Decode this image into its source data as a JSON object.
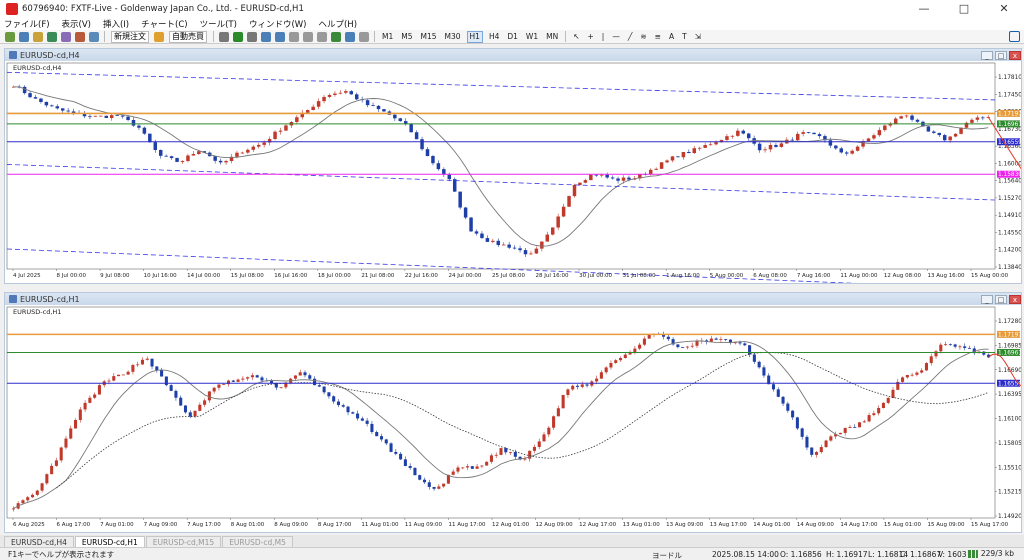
{
  "app": {
    "title": "60796940: FXTF-Live - Goldenway Japan Co., Ltd. - EURUSD-cd,H1",
    "window_controls": [
      "—",
      "□",
      "✕"
    ]
  },
  "menu": [
    "ファイル(F)",
    "表示(V)",
    "挿入(I)",
    "チャート(C)",
    "ツール(T)",
    "ウィンドウ(W)",
    "ヘルプ(H)"
  ],
  "toolbar": {
    "new_order": "新規注文",
    "auto_trade": "自動売買",
    "timeframes": [
      "M1",
      "M5",
      "M15",
      "M30",
      "H1",
      "H4",
      "D1",
      "W1",
      "MN"
    ],
    "active_timeframe": "H1"
  },
  "chart_h4": {
    "window_title": "EURUSD-cd,H4",
    "symbol_label": "EURUSD-cd,H4",
    "price_ticks": [
      "1.17810",
      "1.17450",
      "1.17090",
      "1.16730",
      "1.16360",
      "1.16000",
      "1.15640",
      "1.15270",
      "1.14910",
      "1.14550",
      "1.14200",
      "1.13840"
    ],
    "price_labels": [
      {
        "text": "1.17197",
        "color": "#e69a3a"
      },
      {
        "text": "1.16961",
        "color": "#2e8b2e"
      },
      {
        "text": "1.16559",
        "color": "#2d2dcc"
      },
      {
        "text": "1.15830",
        "color": "#ee22ee"
      }
    ],
    "time_ticks": [
      "4 Jul 2025",
      "8 Jul 00:00",
      "9 Jul 08:00",
      "10 Jul 16:00",
      "14 Jul 00:00",
      "15 Jul 08:00",
      "16 Jul 16:00",
      "18 Jul 00:00",
      "21 Jul 08:00",
      "22 Jul 16:00",
      "24 Jul 00:00",
      "25 Jul 08:00",
      "28 Jul 16:00",
      "30 Jul 00:00",
      "31 Jul 08:00",
      "1 Aug 16:00",
      "5 Aug 00:00",
      "6 Aug 08:00",
      "7 Aug 16:00",
      "11 Aug 00:00",
      "12 Aug 08:00",
      "13 Aug 16:00",
      "15 Aug 00:00"
    ]
  },
  "chart_h1": {
    "window_title": "EURUSD-cd,H1",
    "symbol_label": "EURUSD-cd,H1",
    "price_ticks": [
      "1.17280",
      "1.16985",
      "1.16690",
      "1.16395",
      "1.16100",
      "1.15805",
      "1.15510",
      "1.15215",
      "1.14920"
    ],
    "price_labels": [
      {
        "text": "1.17197",
        "color": "#e69a3a"
      },
      {
        "text": "1.16961",
        "color": "#2e8b2e"
      },
      {
        "text": "1.16559",
        "color": "#2d2dcc"
      }
    ],
    "time_ticks": [
      "6 Aug 2025",
      "6 Aug 17:00",
      "7 Aug 01:00",
      "7 Aug 09:00",
      "7 Aug 17:00",
      "8 Aug 01:00",
      "8 Aug 09:00",
      "8 Aug 17:00",
      "11 Aug 01:00",
      "11 Aug 09:00",
      "11 Aug 17:00",
      "12 Aug 01:00",
      "12 Aug 09:00",
      "12 Aug 17:00",
      "13 Aug 01:00",
      "13 Aug 09:00",
      "13 Aug 17:00",
      "14 Aug 01:00",
      "14 Aug 09:00",
      "14 Aug 17:00",
      "15 Aug 01:00",
      "15 Aug 09:00",
      "15 Aug 17:00"
    ]
  },
  "tabs": [
    {
      "label": "EURUSD-cd,H4",
      "state": "normal"
    },
    {
      "label": "EURUSD-cd,H1",
      "state": "active"
    },
    {
      "label": "EURUSD-cd,M15",
      "state": "dim"
    },
    {
      "label": "EURUSD-cd,M5",
      "state": "dim"
    }
  ],
  "status": {
    "help_text": "F1キーでヘルプが表示されます",
    "profile": "ヨードル",
    "datetime": "2025.08.15 14:00",
    "open": "O: 1.16856",
    "high": "H: 1.16917",
    "low": "L: 1.16814",
    "close": "C: 1.16867",
    "volume": "V: 1603",
    "traffic": "229/3 kb"
  },
  "chart_data": [
    {
      "type": "candlestick",
      "title": "EURUSD-cd,H4",
      "ylim": [
        1.137,
        1.1815
      ],
      "x": [
        "4 Jul 2025",
        "8 Jul 00:00",
        "9 Jul 08:00",
        "10 Jul 16:00",
        "14 Jul 00:00",
        "15 Jul 08:00",
        "16 Jul 16:00",
        "18 Jul 00:00",
        "21 Jul 08:00",
        "22 Jul 16:00",
        "24 Jul 00:00",
        "25 Jul 08:00",
        "28 Jul 16:00",
        "30 Jul 00:00",
        "31 Jul 08:00",
        "1 Aug 16:00",
        "5 Aug 00:00",
        "6 Aug 08:00",
        "7 Aug 16:00",
        "11 Aug 00:00",
        "12 Aug 08:00",
        "13 Aug 16:00",
        "15 Aug 00:00"
      ],
      "close_path": [
        1.1784,
        1.1752,
        1.173,
        1.1718,
        1.1712,
        1.1715,
        1.169,
        1.1625,
        1.161,
        1.164,
        1.1605,
        1.1635,
        1.1652,
        1.169,
        1.172,
        1.176,
        1.177,
        1.174,
        1.172,
        1.169,
        1.162,
        1.157,
        1.146,
        1.143,
        1.142,
        1.14,
        1.146,
        1.156,
        1.1585,
        1.157,
        1.1575,
        1.16,
        1.1625,
        1.164,
        1.166,
        1.168,
        1.164,
        1.165,
        1.1675,
        1.1665,
        1.1625,
        1.1655,
        1.169,
        1.172,
        1.168,
        1.166,
        1.17,
        1.1714
      ],
      "horizontal_levels": [
        {
          "price": 1.17197,
          "color": "#e69a3a"
        },
        {
          "price": 1.16961,
          "color": "#2e8b2e"
        },
        {
          "price": 1.16559,
          "color": "#2d2dcc"
        },
        {
          "price": 1.1583,
          "color": "#ee22ee"
        }
      ]
    },
    {
      "type": "candlestick",
      "title": "EURUSD-cd,H1",
      "ylim": [
        1.148,
        1.1745
      ],
      "x": [
        "6 Aug 2025",
        "6 Aug 17:00",
        "7 Aug 01:00",
        "7 Aug 09:00",
        "7 Aug 17:00",
        "8 Aug 01:00",
        "8 Aug 09:00",
        "8 Aug 17:00",
        "11 Aug 01:00",
        "11 Aug 09:00",
        "11 Aug 17:00",
        "12 Aug 01:00",
        "12 Aug 09:00",
        "12 Aug 17:00",
        "13 Aug 01:00",
        "13 Aug 09:00",
        "13 Aug 17:00",
        "14 Aug 01:00",
        "14 Aug 09:00",
        "14 Aug 17:00",
        "15 Aug 01:00",
        "15 Aug 09:00",
        "15 Aug 17:00"
      ],
      "close_path": [
        1.1495,
        1.151,
        1.156,
        1.162,
        1.1655,
        1.167,
        1.169,
        1.165,
        1.161,
        1.165,
        1.166,
        1.1665,
        1.165,
        1.167,
        1.1645,
        1.162,
        1.16,
        1.157,
        1.154,
        1.1515,
        1.1545,
        1.1545,
        1.157,
        1.1555,
        1.159,
        1.165,
        1.1655,
        1.1685,
        1.17,
        1.1725,
        1.17,
        1.171,
        1.1715,
        1.1705,
        1.166,
        1.162,
        1.156,
        1.159,
        1.16,
        1.162,
        1.166,
        1.1675,
        1.171,
        1.17,
        1.1692
      ],
      "horizontal_levels": [
        {
          "price": 1.17197,
          "color": "#e69a3a"
        },
        {
          "price": 1.16961,
          "color": "#2e8b2e"
        },
        {
          "price": 1.16559,
          "color": "#2d2dcc"
        }
      ]
    }
  ]
}
